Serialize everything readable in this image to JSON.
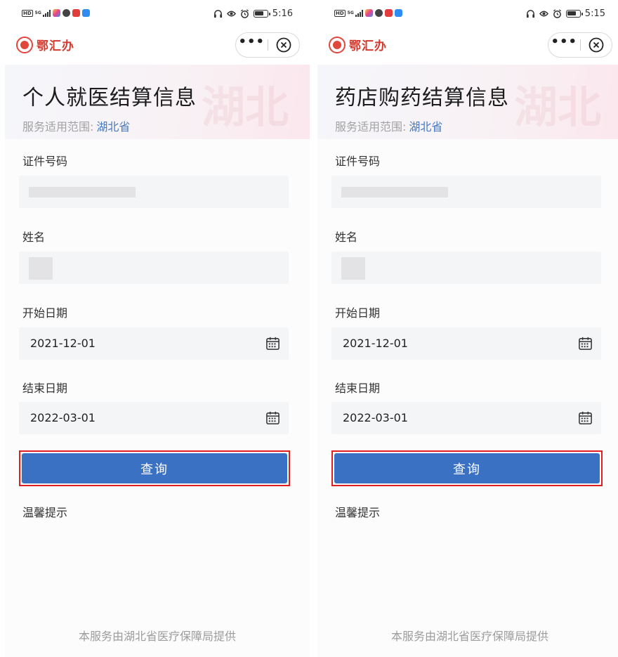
{
  "left_screen": {
    "status": {
      "network": "5G",
      "time": "5:16"
    },
    "nav": {
      "app_name": "鄂汇办"
    },
    "header": {
      "title": "个人就医结算信息",
      "scope_label": "服务适用范围:",
      "scope_value": "湖北省"
    },
    "form": {
      "id_label": "证件号码",
      "name_label": "姓名",
      "start_label": "开始日期",
      "start_value": "2021-12-01",
      "end_label": "结束日期",
      "end_value": "2022-03-01",
      "query_label": "查询"
    },
    "tips_label": "温馨提示",
    "footer": "本服务由湖北省医疗保障局提供"
  },
  "right_screen": {
    "status": {
      "network": "5G",
      "time": "5:15"
    },
    "nav": {
      "app_name": "鄂汇办"
    },
    "header": {
      "title": "药店购药结算信息",
      "scope_label": "服务适用范围:",
      "scope_value": "湖北省"
    },
    "form": {
      "id_label": "证件号码",
      "name_label": "姓名",
      "start_label": "开始日期",
      "start_value": "2021-12-01",
      "end_label": "结束日期",
      "end_value": "2022-03-01",
      "query_label": "查询"
    },
    "tips_label": "温馨提示",
    "footer": "本服务由湖北省医疗保障局提供"
  },
  "colors": {
    "primary": "#3a71c2",
    "highlight_border": "#e02020",
    "scope_link": "#4678c0",
    "brand_red": "#d23a2f"
  },
  "icons": [
    "more-icon",
    "close-circle-icon",
    "calendar-icon",
    "logo-icon",
    "headphones-icon",
    "eye-icon",
    "alarm-icon",
    "battery-icon"
  ]
}
